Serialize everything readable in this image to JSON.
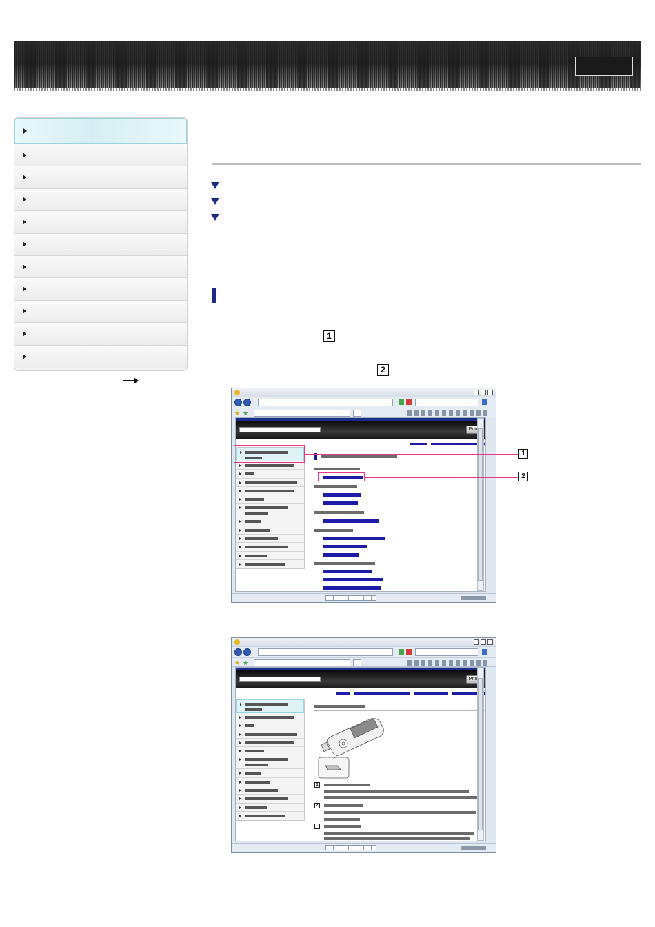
{
  "figure": {
    "callouts": [
      "1",
      "2"
    ],
    "print_label": "Print"
  },
  "icons": {
    "sidebar_marker": "triangle-right-icon",
    "page_jump": "triangle-down-icon",
    "more_arrow": "arrow-right-icon"
  },
  "colors": {
    "accent_blue": "#1c2a88",
    "callout_pink": "#e53888",
    "sidebar_active": "#dff2f6"
  }
}
